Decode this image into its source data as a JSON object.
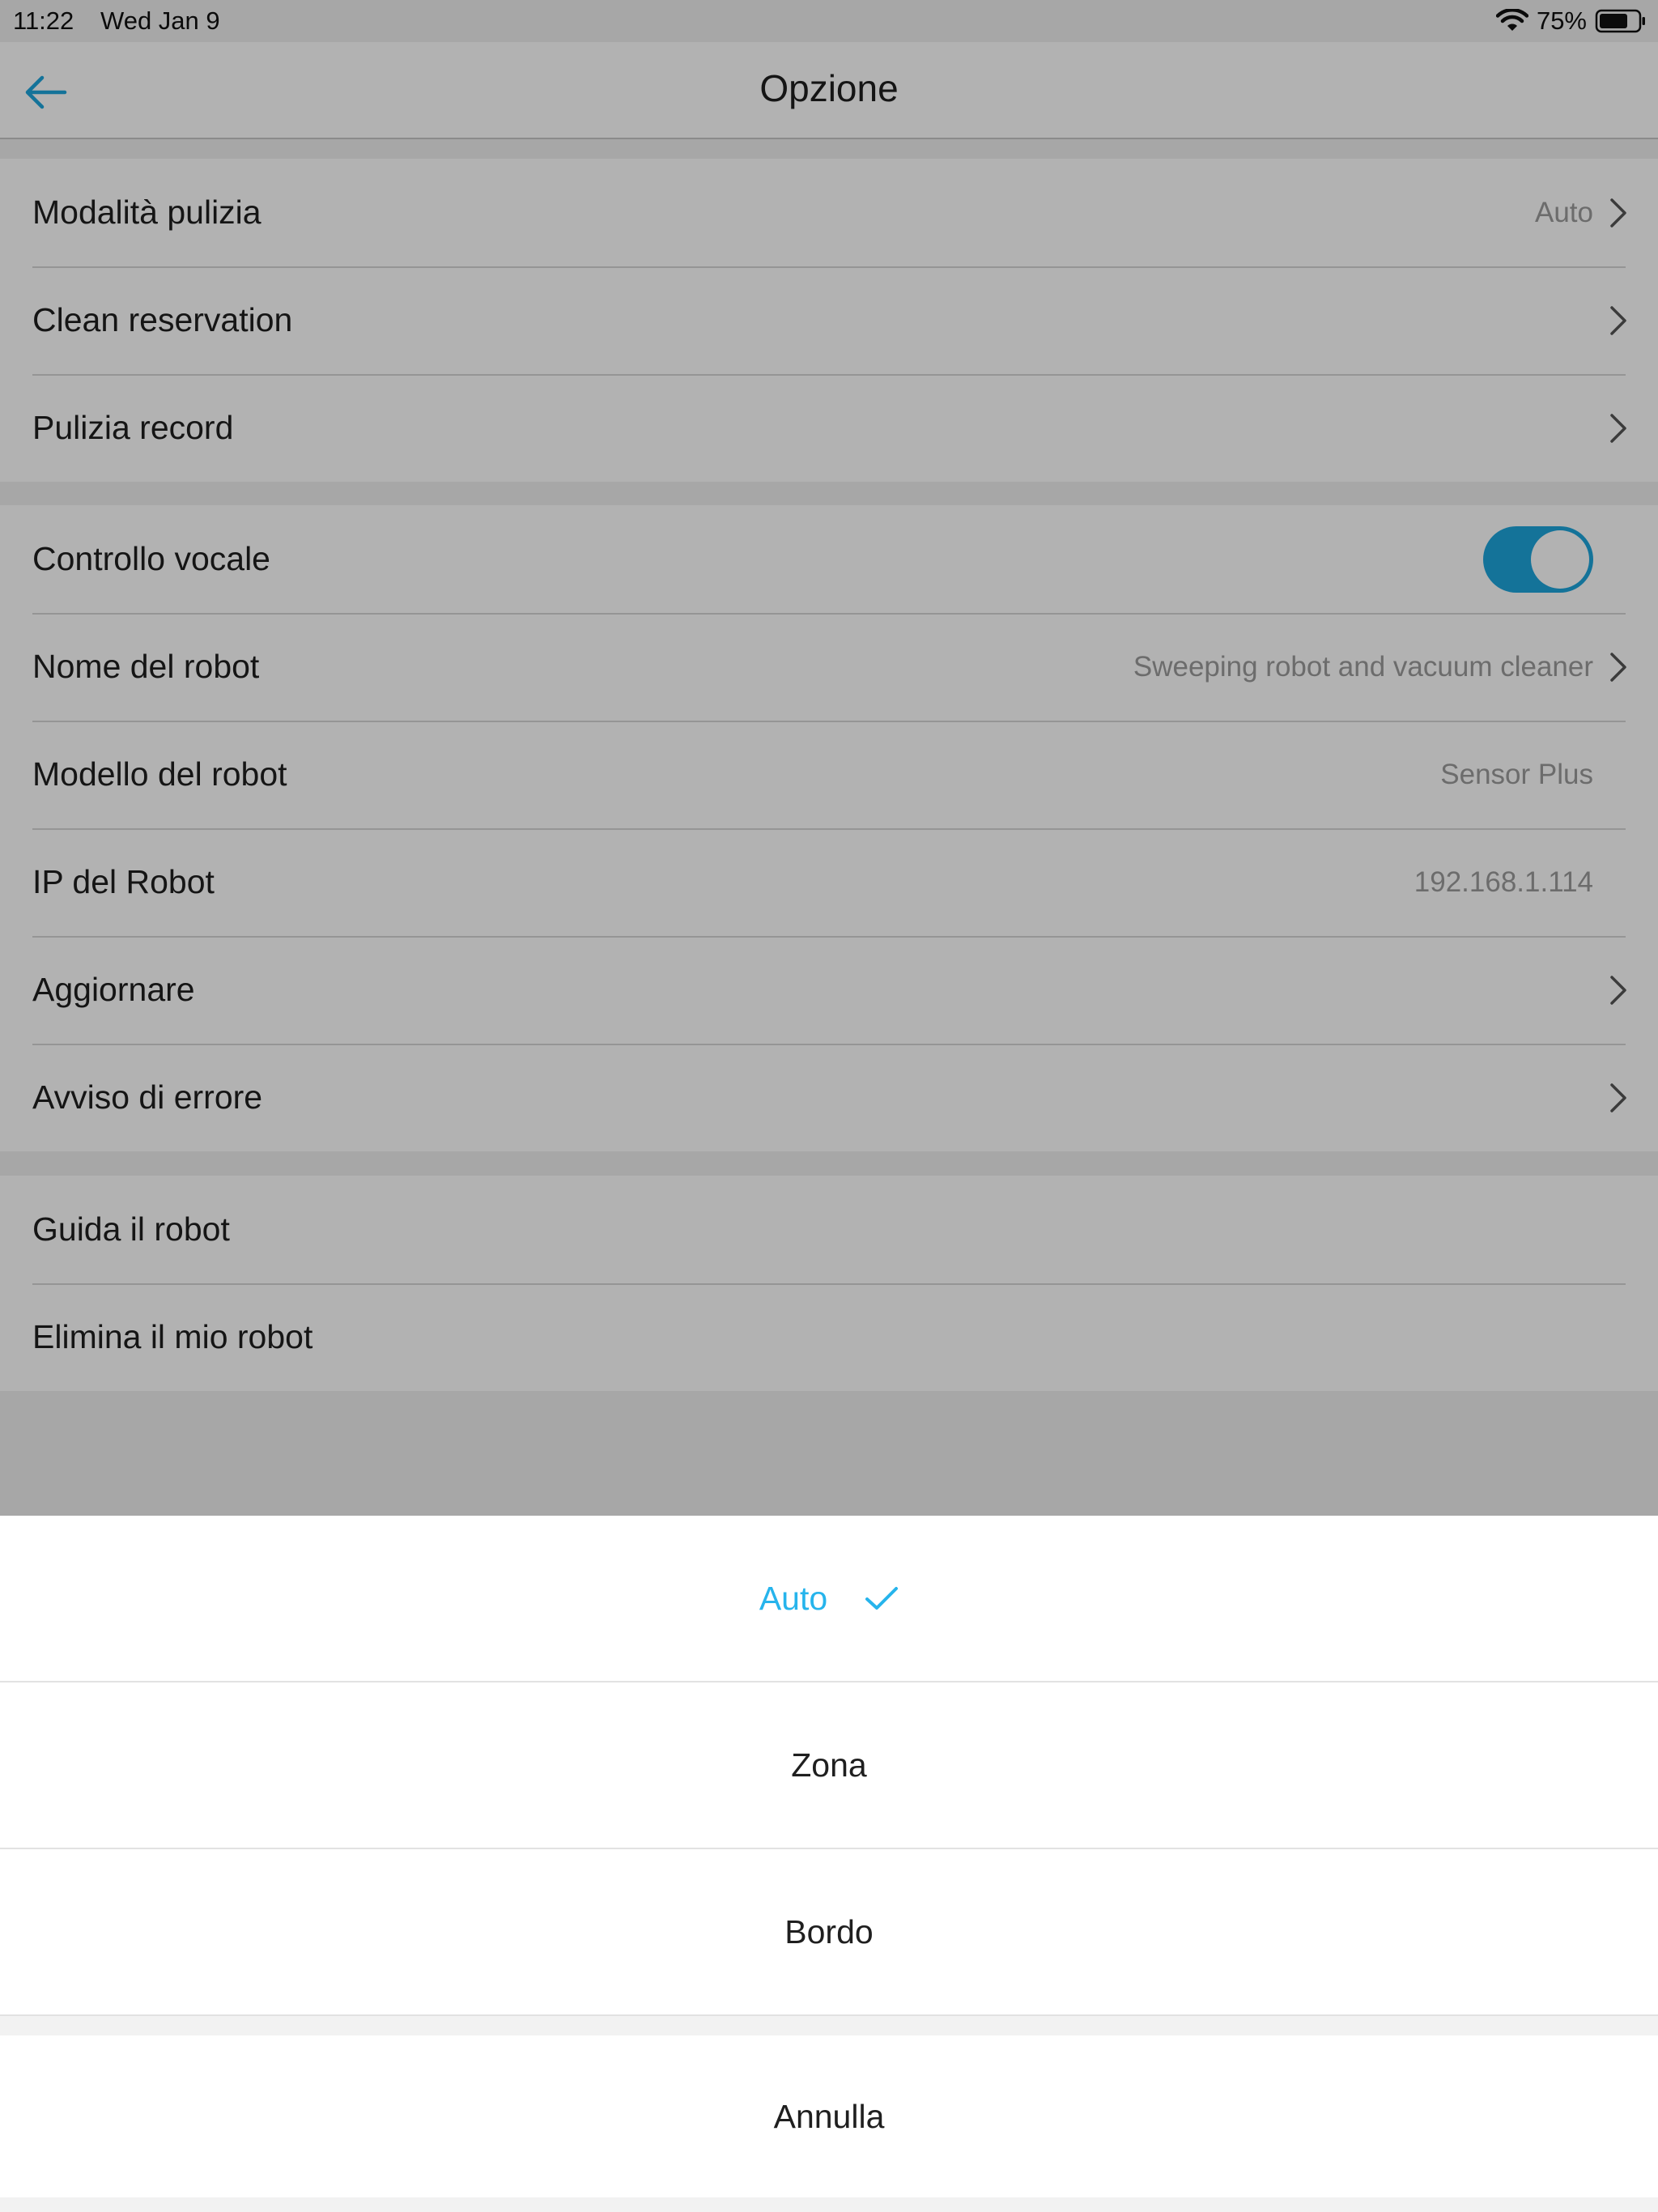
{
  "status_bar": {
    "time": "11:22",
    "date": "Wed Jan 9",
    "battery_percent": "75%",
    "icons": [
      "wifi-icon",
      "battery-icon"
    ]
  },
  "nav": {
    "title": "Opzione",
    "back_icon": "arrow-left-icon"
  },
  "sections": [
    {
      "rows": [
        {
          "label": "Modalità pulizia",
          "value": "Auto",
          "chevron": true
        },
        {
          "label": "Clean reservation",
          "value": "",
          "chevron": true
        },
        {
          "label": "Pulizia record",
          "value": "",
          "chevron": true
        }
      ]
    },
    {
      "rows": [
        {
          "label": "Controllo vocale",
          "toggle": true,
          "toggle_on": true
        },
        {
          "label": "Nome del robot",
          "value": "Sweeping robot and vacuum cleaner",
          "chevron": true
        },
        {
          "label": "Modello del robot",
          "value": "Sensor Plus",
          "chevron": false
        },
        {
          "label": "IP del Robot",
          "value": "192.168.1.114",
          "chevron": false
        },
        {
          "label": "Aggiornare",
          "value": "",
          "chevron": true
        },
        {
          "label": "Avviso di errore",
          "value": "",
          "chevron": true
        }
      ]
    },
    {
      "rows": [
        {
          "label": "Guida il robot",
          "value": "",
          "chevron": false
        },
        {
          "label": "Elimina il mio robot",
          "value": "",
          "chevron": false
        }
      ]
    }
  ],
  "action_sheet": {
    "options": [
      {
        "label": "Auto",
        "selected": true
      },
      {
        "label": "Zona",
        "selected": false
      },
      {
        "label": "Bordo",
        "selected": false
      }
    ],
    "cancel_label": "Annulla",
    "accent_color": "#26b4ec"
  },
  "colors": {
    "toggle_on": "#1ea5dc",
    "back_arrow": "#1ea5dc"
  }
}
